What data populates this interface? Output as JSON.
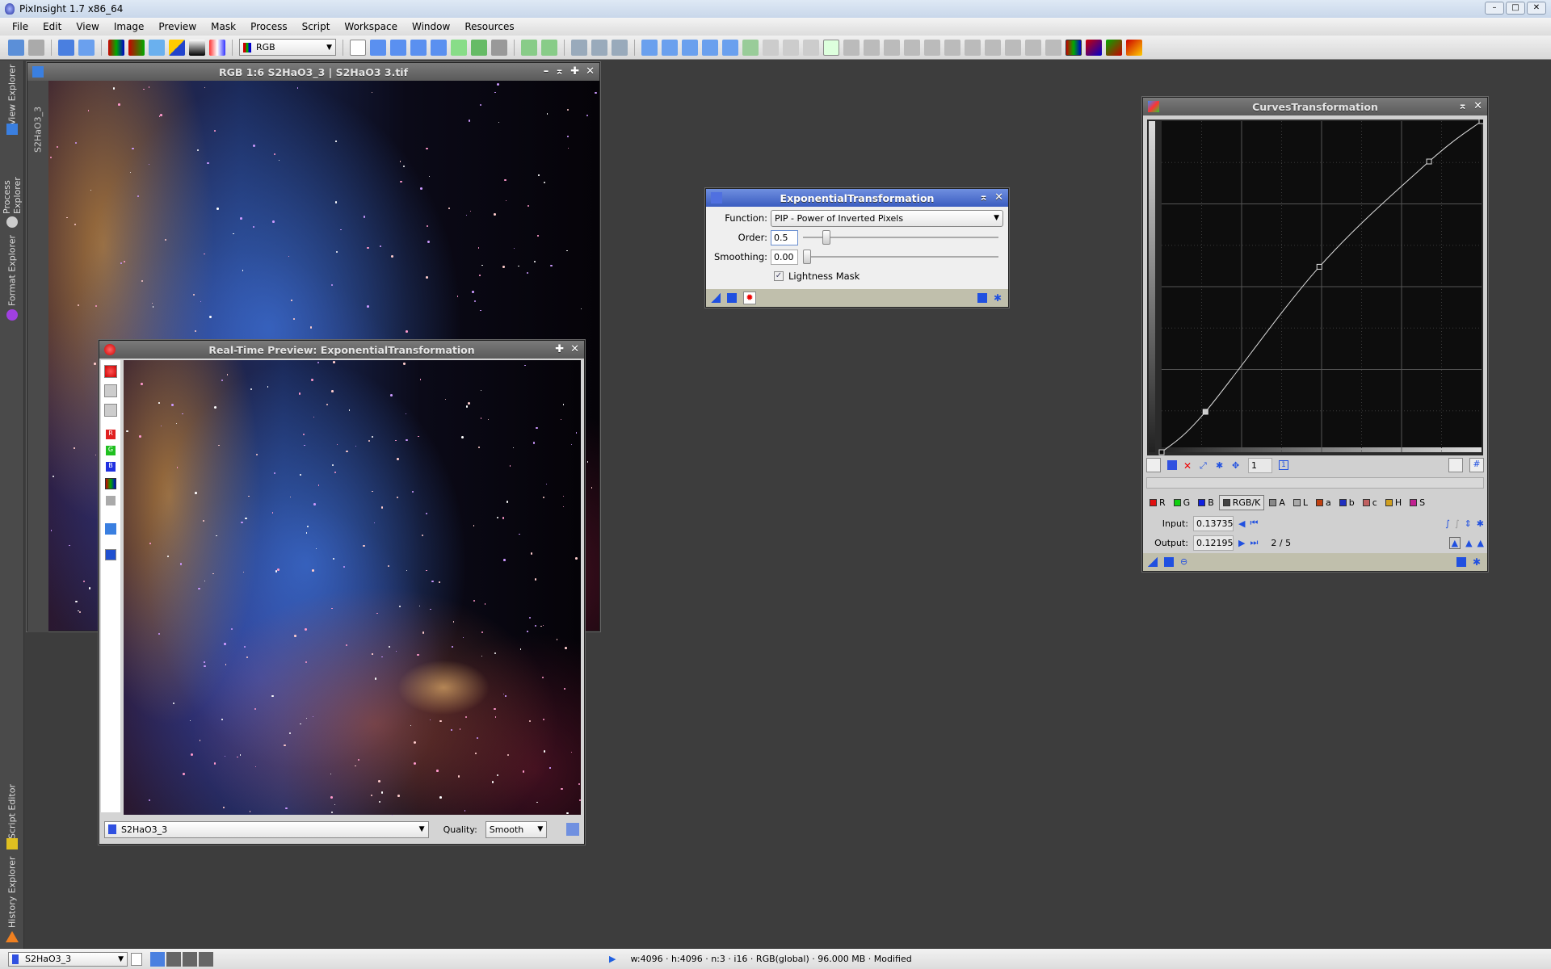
{
  "app": {
    "title": "PixInsight 1.7 x86_64"
  },
  "menu": [
    "File",
    "Edit",
    "View",
    "Image",
    "Preview",
    "Mask",
    "Process",
    "Script",
    "Workspace",
    "Window",
    "Resources"
  ],
  "toolbar": {
    "color_mode": "RGB"
  },
  "sidebar": {
    "tabs": [
      "View Explorer",
      "Process Explorer",
      "Format Explorer",
      "Script Editor",
      "History Explorer"
    ]
  },
  "image_window": {
    "title": "RGB 1:6 S2HaO3_3 | S2HaO3 3.tif",
    "side_label": "S2HaO3_3"
  },
  "preview_window": {
    "title": "Real-Time Preview: ExponentialTransformation",
    "view_select": "S2HaO3_3",
    "quality_label": "Quality:",
    "quality_value": "Smooth",
    "channel_buttons": [
      "R",
      "G",
      "B"
    ]
  },
  "exp_dialog": {
    "title": "ExponentialTransformation",
    "function_label": "Function:",
    "function_value": "PIP - Power of Inverted Pixels",
    "order_label": "Order:",
    "order_value": "0.5",
    "order_fraction": 0.1,
    "smoothing_label": "Smoothing:",
    "smoothing_value": "0.00",
    "lightness_mask_label": "Lightness Mask",
    "lightness_mask_checked": true
  },
  "curves": {
    "title": "CurvesTransformation",
    "zoom_value": "1",
    "channels": [
      {
        "label": "R",
        "color": "#e01010"
      },
      {
        "label": "G",
        "color": "#10d010"
      },
      {
        "label": "B",
        "color": "#1020e0"
      },
      {
        "label": "RGB/K",
        "color": "#444"
      },
      {
        "label": "A",
        "color": "#888"
      },
      {
        "label": "L",
        "color": "#aaa"
      },
      {
        "label": "a",
        "color": "#c04010"
      },
      {
        "label": "b",
        "color": "#2030c0"
      },
      {
        "label": "c",
        "color": "#c06060"
      },
      {
        "label": "H",
        "color": "#d0a020"
      },
      {
        "label": "S",
        "color": "#c02090"
      }
    ],
    "active_channel": "RGB/K",
    "input_label": "Input:",
    "input_value": "0.13735",
    "output_label": "Output:",
    "output_value": "0.12195",
    "point_index": "2 / 5",
    "points": [
      [
        0,
        0
      ],
      [
        0.137,
        0.122
      ],
      [
        0.493,
        0.56
      ],
      [
        0.836,
        0.878
      ],
      [
        1,
        1
      ]
    ]
  },
  "statusbar": {
    "view": "S2HaO3_3",
    "info": "w:4096 · h:4096 · n:3 · i16 · RGB(global) · 96.000 MB · Modified"
  }
}
